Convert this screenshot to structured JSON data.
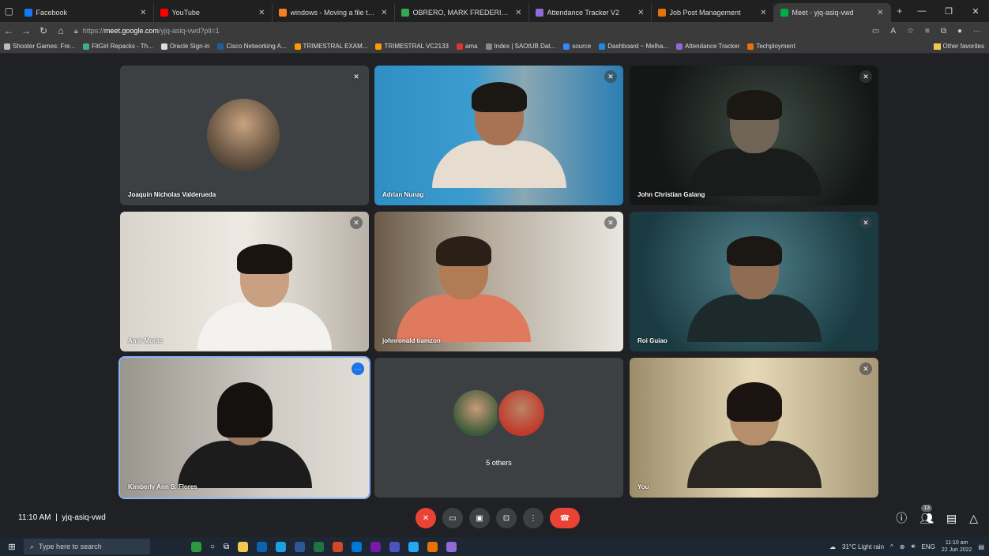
{
  "browser": {
    "tabs": [
      {
        "label": "Facebook",
        "color": "#1877f2"
      },
      {
        "label": "YouTube",
        "color": "#ff0000"
      },
      {
        "label": "windows - Moving a file to the F",
        "color": "#f48024"
      },
      {
        "label": "OBRERO, MARK FREDERICK B. N",
        "color": "#34a853"
      },
      {
        "label": "Attendance Tracker V2",
        "color": "#8e6bd8"
      },
      {
        "label": "Job Post Management",
        "color": "#e8710a"
      },
      {
        "label": "Meet - yjq-asiq-vwd",
        "color": "#00ac47"
      }
    ],
    "url_prefix": "https://",
    "url_domain": "meet.google.com",
    "url_path": "/yjq-asiq-vwd?pli=1",
    "bookmarks": [
      "Shooter Games: Fre...",
      "FitGirl Repacks - Th...",
      "Oracle Sign-in",
      "Cisco Networking A...",
      "TRIMESTRAL EXAM...",
      "TRIMESTRAL VC2133",
      "ama",
      "Index | SAOtUB Dat...",
      "source",
      "Dashboard ~ Melha...",
      "Attendance Tracker",
      "Techployment"
    ],
    "other_favorites": "Other favorites"
  },
  "meet": {
    "participants": [
      {
        "name": "Joaquin Nicholas Valderueda"
      },
      {
        "name": "Adrian Nunag"
      },
      {
        "name": "John Christian Galang"
      },
      {
        "name": "Amir Monte"
      },
      {
        "name": "johnronald tiamzon"
      },
      {
        "name": "Roi Guiao"
      },
      {
        "name": "Kimberly Ann S. Flores"
      },
      {
        "name": "5 others"
      },
      {
        "name": "You"
      }
    ],
    "time": "11:10 AM",
    "separator": "|",
    "meeting_code": "yjq-asiq-vwd",
    "people_count": "13"
  },
  "taskbar": {
    "search_placeholder": "Type here to search",
    "weather": "31°C Light rain",
    "lang": "ENG",
    "time": "11:10 am",
    "date": "22 Jun 2022"
  }
}
